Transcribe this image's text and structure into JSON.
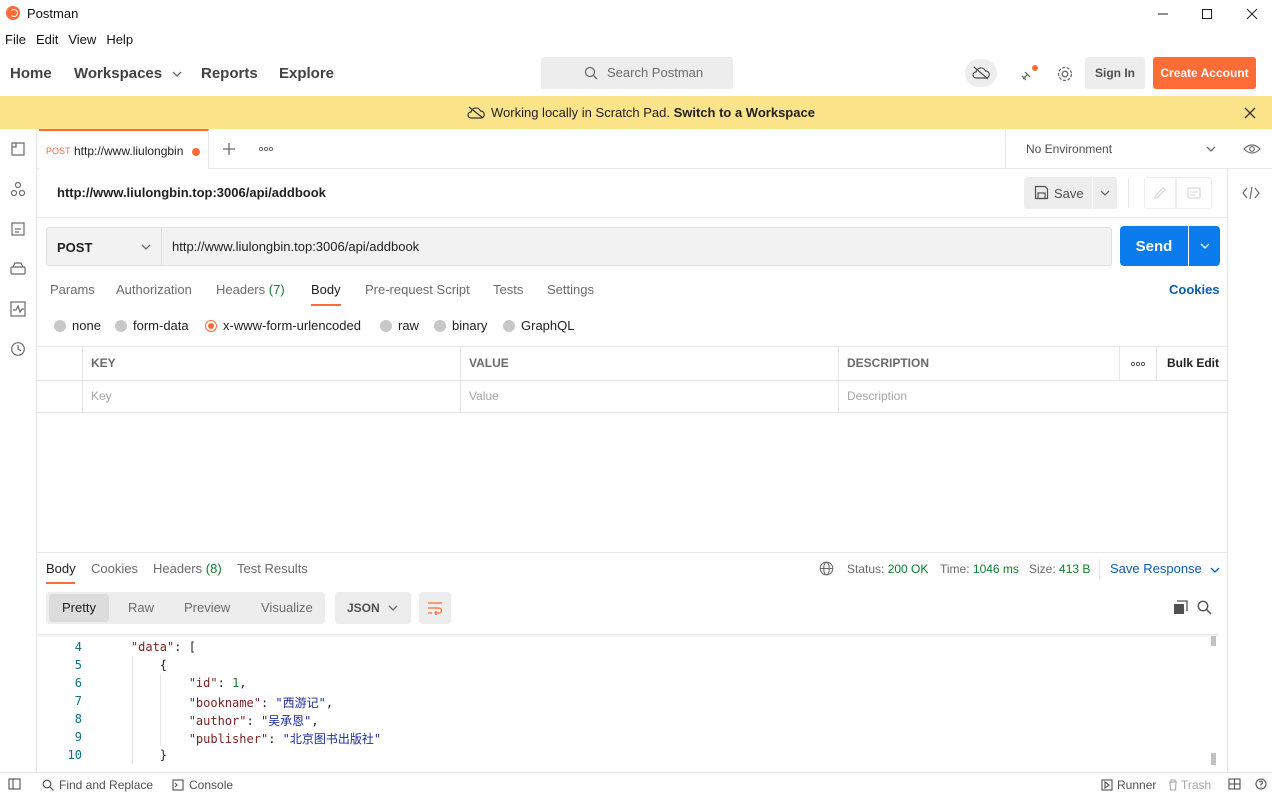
{
  "window": {
    "title": "Postman",
    "controls": [
      "minimize",
      "maximize",
      "close"
    ]
  },
  "menu": [
    "File",
    "Edit",
    "View",
    "Help"
  ],
  "header": {
    "nav": [
      "Home",
      "Workspaces",
      "Reports",
      "Explore"
    ],
    "search_placeholder": "Search Postman",
    "sign_in": "Sign In",
    "create_account": "Create Account"
  },
  "banner": {
    "message": "Working locally in Scratch Pad.",
    "link": "Switch to a Workspace"
  },
  "tabs": {
    "active": {
      "method": "POST",
      "url": "http://www.liulongbin"
    },
    "environment": "No Environment"
  },
  "request": {
    "title": "http://www.liulongbin.top:3006/api/addbook",
    "save_label": "Save",
    "method": "POST",
    "url": "http://www.liulongbin.top:3006/api/addbook",
    "send_label": "Send",
    "tabs": {
      "params": "Params",
      "authorization": "Authorization",
      "headers": "Headers",
      "headers_count": "(7)",
      "body": "Body",
      "prerequest": "Pre-request Script",
      "tests": "Tests",
      "settings": "Settings"
    },
    "cookies": "Cookies",
    "body_modes": [
      "none",
      "form-data",
      "x-www-form-urlencoded",
      "raw",
      "binary",
      "GraphQL"
    ],
    "selected_body_mode": "x-www-form-urlencoded",
    "table": {
      "headers": [
        "KEY",
        "VALUE",
        "DESCRIPTION"
      ],
      "bulk_edit": "Bulk Edit",
      "placeholders": [
        "Key",
        "Value",
        "Description"
      ]
    }
  },
  "response": {
    "tabs": {
      "body": "Body",
      "cookies": "Cookies",
      "headers": "Headers",
      "headers_count": "(8)",
      "test_results": "Test Results"
    },
    "status_label": "Status:",
    "status_value": "200 OK",
    "time_label": "Time:",
    "time_value": "1046 ms",
    "size_label": "Size:",
    "size_value": "413 B",
    "save_response": "Save Response",
    "view_tabs": [
      "Pretty",
      "Raw",
      "Preview",
      "Visualize"
    ],
    "format": "JSON",
    "code_lines": [
      {
        "n": "4",
        "indent": "    ",
        "key": "\"data\"",
        "sep": ": ",
        "val": "[",
        "vtype": "p",
        "tail": ""
      },
      {
        "n": "5",
        "indent": "        ",
        "key": "",
        "sep": "",
        "val": "{",
        "vtype": "p",
        "tail": ""
      },
      {
        "n": "6",
        "indent": "            ",
        "key": "\"id\"",
        "sep": ": ",
        "val": "1",
        "vtype": "n",
        "tail": ","
      },
      {
        "n": "7",
        "indent": "            ",
        "key": "\"bookname\"",
        "sep": ": ",
        "val": "\"西游记\"",
        "vtype": "s",
        "tail": ","
      },
      {
        "n": "8",
        "indent": "            ",
        "key": "\"author\"",
        "sep": ": ",
        "val": "\"吴承恩\"",
        "vtype": "s",
        "tail": ","
      },
      {
        "n": "9",
        "indent": "            ",
        "key": "\"publisher\"",
        "sep": ": ",
        "val": "\"北京图书出版社\"",
        "vtype": "s",
        "tail": ""
      },
      {
        "n": "10",
        "indent": "        ",
        "key": "",
        "sep": "",
        "val": "}",
        "vtype": "p",
        "tail": ""
      }
    ]
  },
  "statusbar": {
    "find_replace": "Find and Replace",
    "console": "Console",
    "runner": "Runner",
    "trash": "Trash"
  },
  "colors": {
    "brand": "#ff6c37",
    "send": "#097bed",
    "banner": "#fce48a",
    "link": "#0b5cad",
    "status_ok": "#0d7f2b"
  }
}
